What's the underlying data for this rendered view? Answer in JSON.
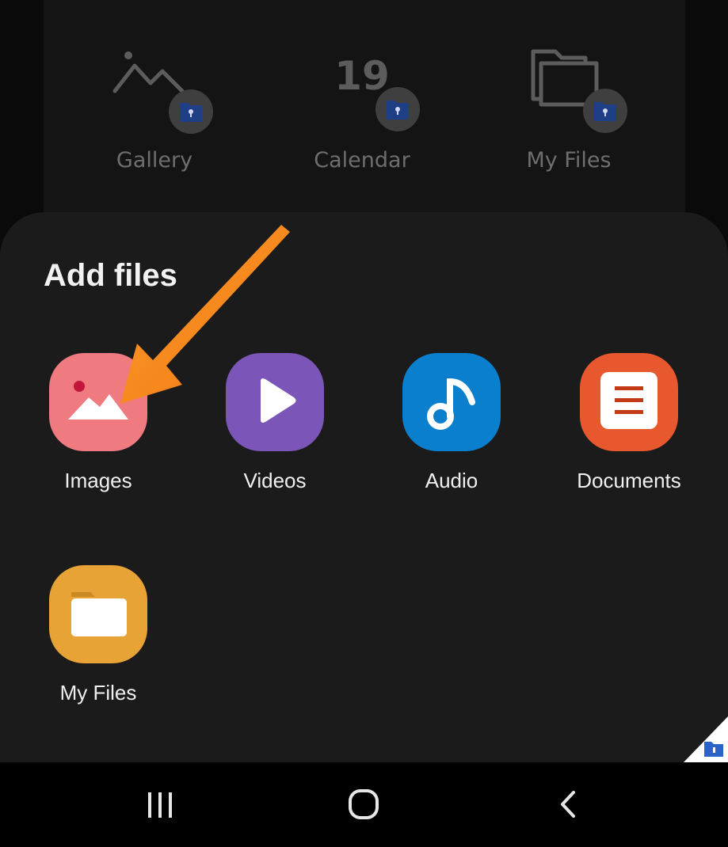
{
  "background": {
    "shortcuts": [
      {
        "label": "Gallery",
        "icon": "mountain-icon"
      },
      {
        "label": "Calendar",
        "icon": "calendar-icon",
        "number": "19"
      },
      {
        "label": "My Files",
        "icon": "folder-icon"
      }
    ]
  },
  "sheet": {
    "title": "Add files",
    "options": [
      {
        "label": "Images",
        "icon": "image-icon",
        "color": "#ef7a80"
      },
      {
        "label": "Videos",
        "icon": "play-icon",
        "color": "#7b55b8"
      },
      {
        "label": "Audio",
        "icon": "music-note-icon",
        "color": "#0a7fce"
      },
      {
        "label": "Documents",
        "icon": "document-icon",
        "color": "#e7582e"
      },
      {
        "label": "My Files",
        "icon": "folder-icon",
        "color": "#e8a337"
      }
    ]
  },
  "annotation": {
    "color": "#f7861c"
  },
  "navbar": {
    "buttons": [
      {
        "icon": "recents-icon"
      },
      {
        "icon": "home-icon"
      },
      {
        "icon": "back-icon"
      }
    ]
  }
}
